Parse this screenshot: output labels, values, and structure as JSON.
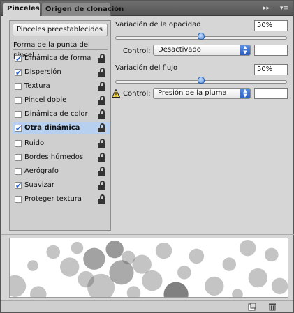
{
  "tabs": [
    {
      "label": "Pinceles",
      "active": true
    },
    {
      "label": "Origen de clonación",
      "active": false
    }
  ],
  "header_buttons": {
    "collapse": "▸▸",
    "menu": "▾≡"
  },
  "presets_button": "Pinceles preestablecidos",
  "brush_tip_shape": "Forma de la punta del pincel",
  "list": [
    {
      "label": "Dinámica de forma",
      "checked": true,
      "selected": false
    },
    {
      "label": "Dispersión",
      "checked": true,
      "selected": false
    },
    {
      "label": "Textura",
      "checked": false,
      "selected": false
    },
    {
      "label": "Pincel doble",
      "checked": false,
      "selected": false
    },
    {
      "label": "Dinámica de color",
      "checked": false,
      "selected": false
    },
    {
      "label": "Otra dinámica",
      "checked": true,
      "selected": true
    },
    {
      "label": "Ruido",
      "checked": false,
      "selected": false
    },
    {
      "label": "Bordes húmedos",
      "checked": false,
      "selected": false
    },
    {
      "label": "Aerógrafo",
      "checked": false,
      "selected": false
    },
    {
      "label": "Suavizar",
      "checked": true,
      "selected": false
    },
    {
      "label": "Proteger textura",
      "checked": false,
      "selected": false
    }
  ],
  "opacity": {
    "label": "Variación de la opacidad",
    "value": "50%",
    "slider_fraction": 0.5,
    "control_label": "Control:",
    "control_value": "Desactivado"
  },
  "flow": {
    "label": "Variación del flujo",
    "value": "50%",
    "slider_fraction": 0.5,
    "control_label": "Control:",
    "control_value": "Presión de la pluma"
  },
  "colors": {
    "accent": "#2a5cc4",
    "selection": "#b8d0ef",
    "panel": "#d6d6d6"
  }
}
